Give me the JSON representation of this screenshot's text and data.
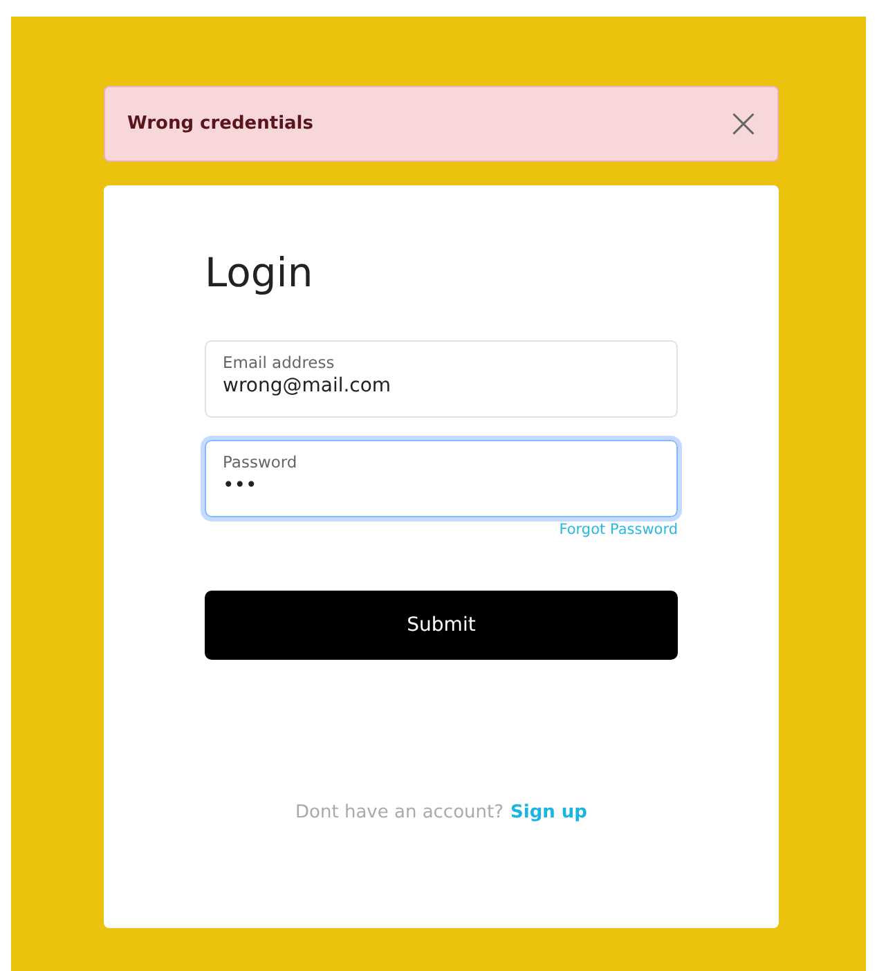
{
  "alert": {
    "message": "Wrong credentials",
    "close": "×"
  },
  "login": {
    "title": "Login",
    "fields": [
      {
        "label": "Email address",
        "value": "wrong@mail.com",
        "focused": false
      },
      {
        "label": "Password",
        "value": "•••",
        "focused": true
      }
    ],
    "forgot_link": "Forgot Password",
    "submit": "Submit",
    "signup_prompt": "Dont have an account?",
    "signup_link": "Sign up"
  }
}
